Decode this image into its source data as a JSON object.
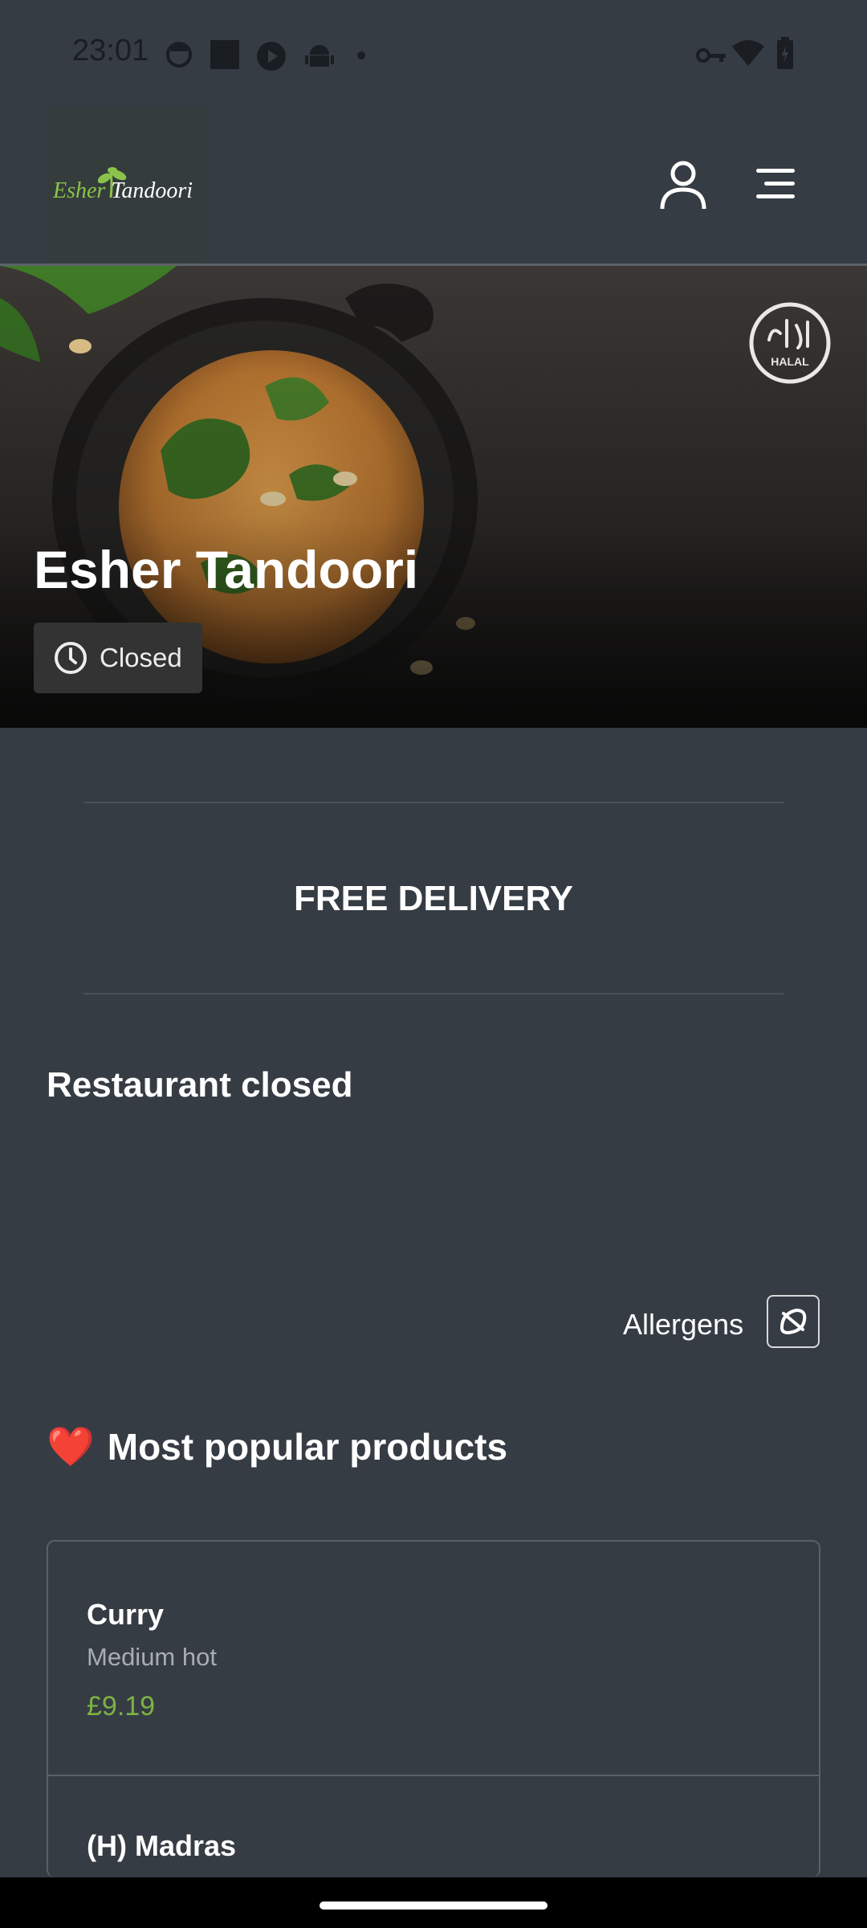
{
  "status_bar": {
    "time": "23:01"
  },
  "header": {
    "logo": {
      "part1": "Esher",
      "part2": "Tandoori"
    },
    "icons": [
      "account-icon",
      "menu-icon"
    ]
  },
  "hero": {
    "title": "Esher Tandoori",
    "status": "Closed",
    "badge_text": "HALAL"
  },
  "banner": {
    "text": "FREE DELIVERY"
  },
  "notice": {
    "text": "Restaurant closed"
  },
  "allergens": {
    "label": "Allergens"
  },
  "popular": {
    "emoji": "❤️",
    "heading": "Most popular products",
    "products": [
      {
        "name": "Curry",
        "description": "Medium hot",
        "price": "£9.19"
      },
      {
        "name": "(H) Madras",
        "description": "",
        "price": ""
      }
    ]
  },
  "colors": {
    "background": "#363c44",
    "price": "#7cb342",
    "accent_green": "#8bc34a"
  }
}
